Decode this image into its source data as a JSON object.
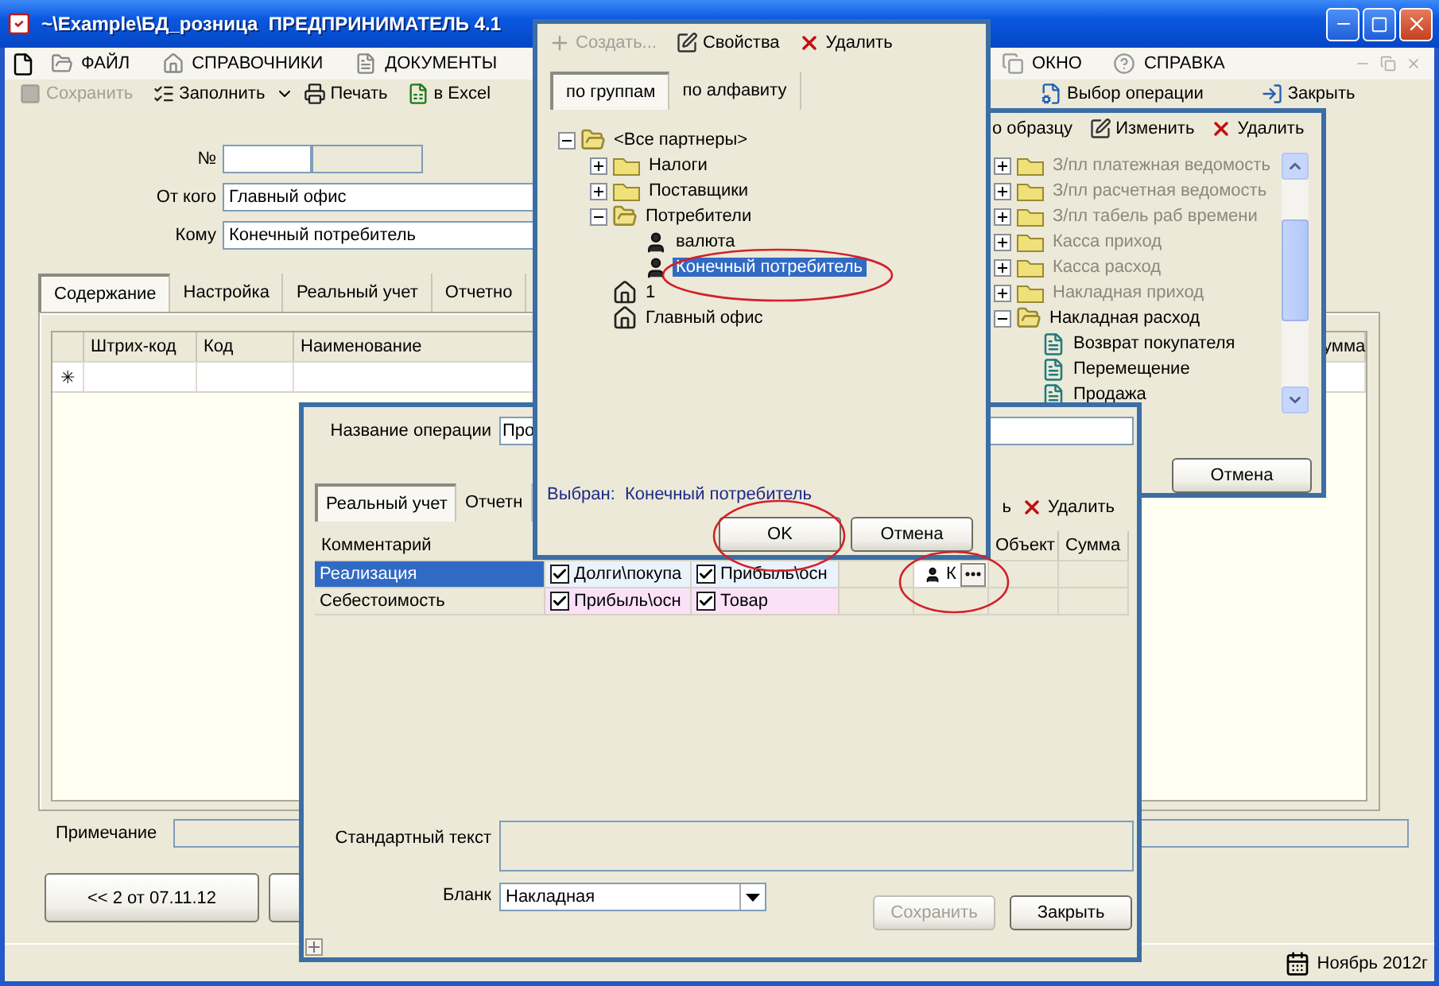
{
  "main_window": {
    "title": "~\\Example\\БД_розница  ПРЕДПРИНИМАТЕЛЬ 4.1",
    "menu_left": [
      {
        "label": "ФАЙЛ"
      },
      {
        "label": "СПРАВОЧНИКИ"
      },
      {
        "label": "ДОКУМЕНТЫ"
      }
    ],
    "menu_right": [
      {
        "label": "ОКНО"
      },
      {
        "label": "СПРАВКА"
      }
    ],
    "toolbar_left": [
      {
        "label": "Сохранить",
        "kind": "button",
        "disabled": true
      },
      {
        "label": "Заполнить",
        "kind": "split",
        "disabled": false
      },
      {
        "label": "Печать",
        "kind": "button",
        "disabled": false
      },
      {
        "label": "в Excel",
        "kind": "button",
        "disabled": false
      }
    ],
    "toolbar_right": [
      {
        "label": "Выбор операции",
        "disabled": false
      },
      {
        "label": "Закрыть",
        "disabled": false
      }
    ],
    "form": {
      "number_label": "№",
      "from_label": "От кого",
      "from_value": "Главный офис",
      "to_label": "Кому",
      "to_value": "Конечный потребитель"
    },
    "tabs": [
      {
        "label": "Содержание",
        "selected": true
      },
      {
        "label": "Настройка",
        "selected": false
      },
      {
        "label": "Реальный учет",
        "selected": false
      },
      {
        "label": "Отчетно",
        "selected": false
      }
    ],
    "grid": {
      "columns": [
        "Штрих-код",
        "Код",
        "Наименование",
        "умма"
      ],
      "new_row_marker": "✳"
    },
    "note_label": "Примечание",
    "nav_button": "<< 2 от 07.11.12",
    "status_bar": {
      "period": "Ноябрь 2012г"
    }
  },
  "operation_types_window": {
    "toolbar": [
      {
        "label": "о образцу"
      },
      {
        "label": "Изменить"
      },
      {
        "label": "Удалить"
      }
    ],
    "tree": [
      {
        "label": "З/пл платежная ведомость",
        "kind": "folder",
        "expanded": false,
        "disabled": true
      },
      {
        "label": "З/пл расчетная ведомость",
        "kind": "folder",
        "expanded": false,
        "disabled": true
      },
      {
        "label": "З/пл табель раб времени",
        "kind": "folder",
        "expanded": false,
        "disabled": true
      },
      {
        "label": "Касса приход",
        "kind": "folder",
        "expanded": false,
        "disabled": true
      },
      {
        "label": "Касса расход",
        "kind": "folder",
        "expanded": false,
        "disabled": true
      },
      {
        "label": "Накладная приход",
        "kind": "folder",
        "expanded": false,
        "disabled": true
      },
      {
        "label": "Накладная расход",
        "kind": "folder",
        "expanded": true,
        "disabled": false,
        "children": [
          {
            "label": "Возврат покупателя",
            "kind": "operation",
            "disabled": false
          },
          {
            "label": "Перемещение",
            "kind": "operation",
            "disabled": false
          },
          {
            "label": "Продажа",
            "kind": "operation",
            "disabled": false
          }
        ]
      }
    ],
    "buttons": [
      {
        "label": "Отмена"
      }
    ]
  },
  "operation_dialog": {
    "name_label": "Название операции",
    "name_value": "Про",
    "tabs": [
      {
        "label": "Реальный учет",
        "selected": true
      },
      {
        "label": "Отчетн",
        "selected": false
      }
    ],
    "toolbar": [
      {
        "label": "ь"
      },
      {
        "label": "Удалить"
      }
    ],
    "table": {
      "columns": [
        "Комментарий",
        "Объект",
        "Сумма"
      ],
      "rows": [
        {
          "comment": "Реализация",
          "selected": true,
          "column_2": {
            "text": "Долги\\покупа",
            "checked": true
          },
          "column_3": {
            "text": "Прибыль\\осн",
            "checked": true
          },
          "column_5": "К"
        },
        {
          "comment": "Себестоимость",
          "selected": false,
          "column_2": {
            "text": "Прибыль\\осн",
            "checked": true
          },
          "column_3": {
            "text": "Товар",
            "checked": true
          }
        }
      ]
    },
    "text_label": "Стандартный текст",
    "form_label": "Бланк",
    "form_value": "Накладная",
    "buttons": [
      {
        "label": "Сохранить",
        "disabled": true
      },
      {
        "label": "Закрыть",
        "disabled": false
      }
    ]
  },
  "partner_dialog": {
    "toolbar": [
      {
        "label": "Создать...",
        "disabled": true
      },
      {
        "label": "Свойства",
        "disabled": false
      },
      {
        "label": "Удалить",
        "disabled": false
      }
    ],
    "tabs": [
      {
        "label": "по группам",
        "selected": true
      },
      {
        "label": "по алфавиту",
        "selected": false
      }
    ],
    "tree": [
      {
        "label": "<Все партнеры>",
        "kind": "folder",
        "expanded": true,
        "selected": false,
        "children": [
          {
            "label": "Налоги",
            "kind": "folder",
            "expanded": false,
            "selected": false
          },
          {
            "label": "Поставщики",
            "kind": "folder",
            "expanded": false,
            "selected": false
          },
          {
            "label": "Потребители",
            "kind": "folder",
            "expanded": true,
            "selected": false,
            "children": [
              {
                "label": "валюта",
                "kind": "person",
                "selected": false
              },
              {
                "label": "Конечный потребитель",
                "kind": "person",
                "selected": true
              }
            ]
          },
          {
            "label": "1",
            "kind": "house",
            "selected": false
          },
          {
            "label": "Главный офис",
            "kind": "house",
            "selected": false
          }
        ]
      }
    ],
    "chosen": "Выбран:  Конечный потребитель",
    "buttons": [
      {
        "label": "OK"
      },
      {
        "label": "Отмена"
      }
    ]
  }
}
